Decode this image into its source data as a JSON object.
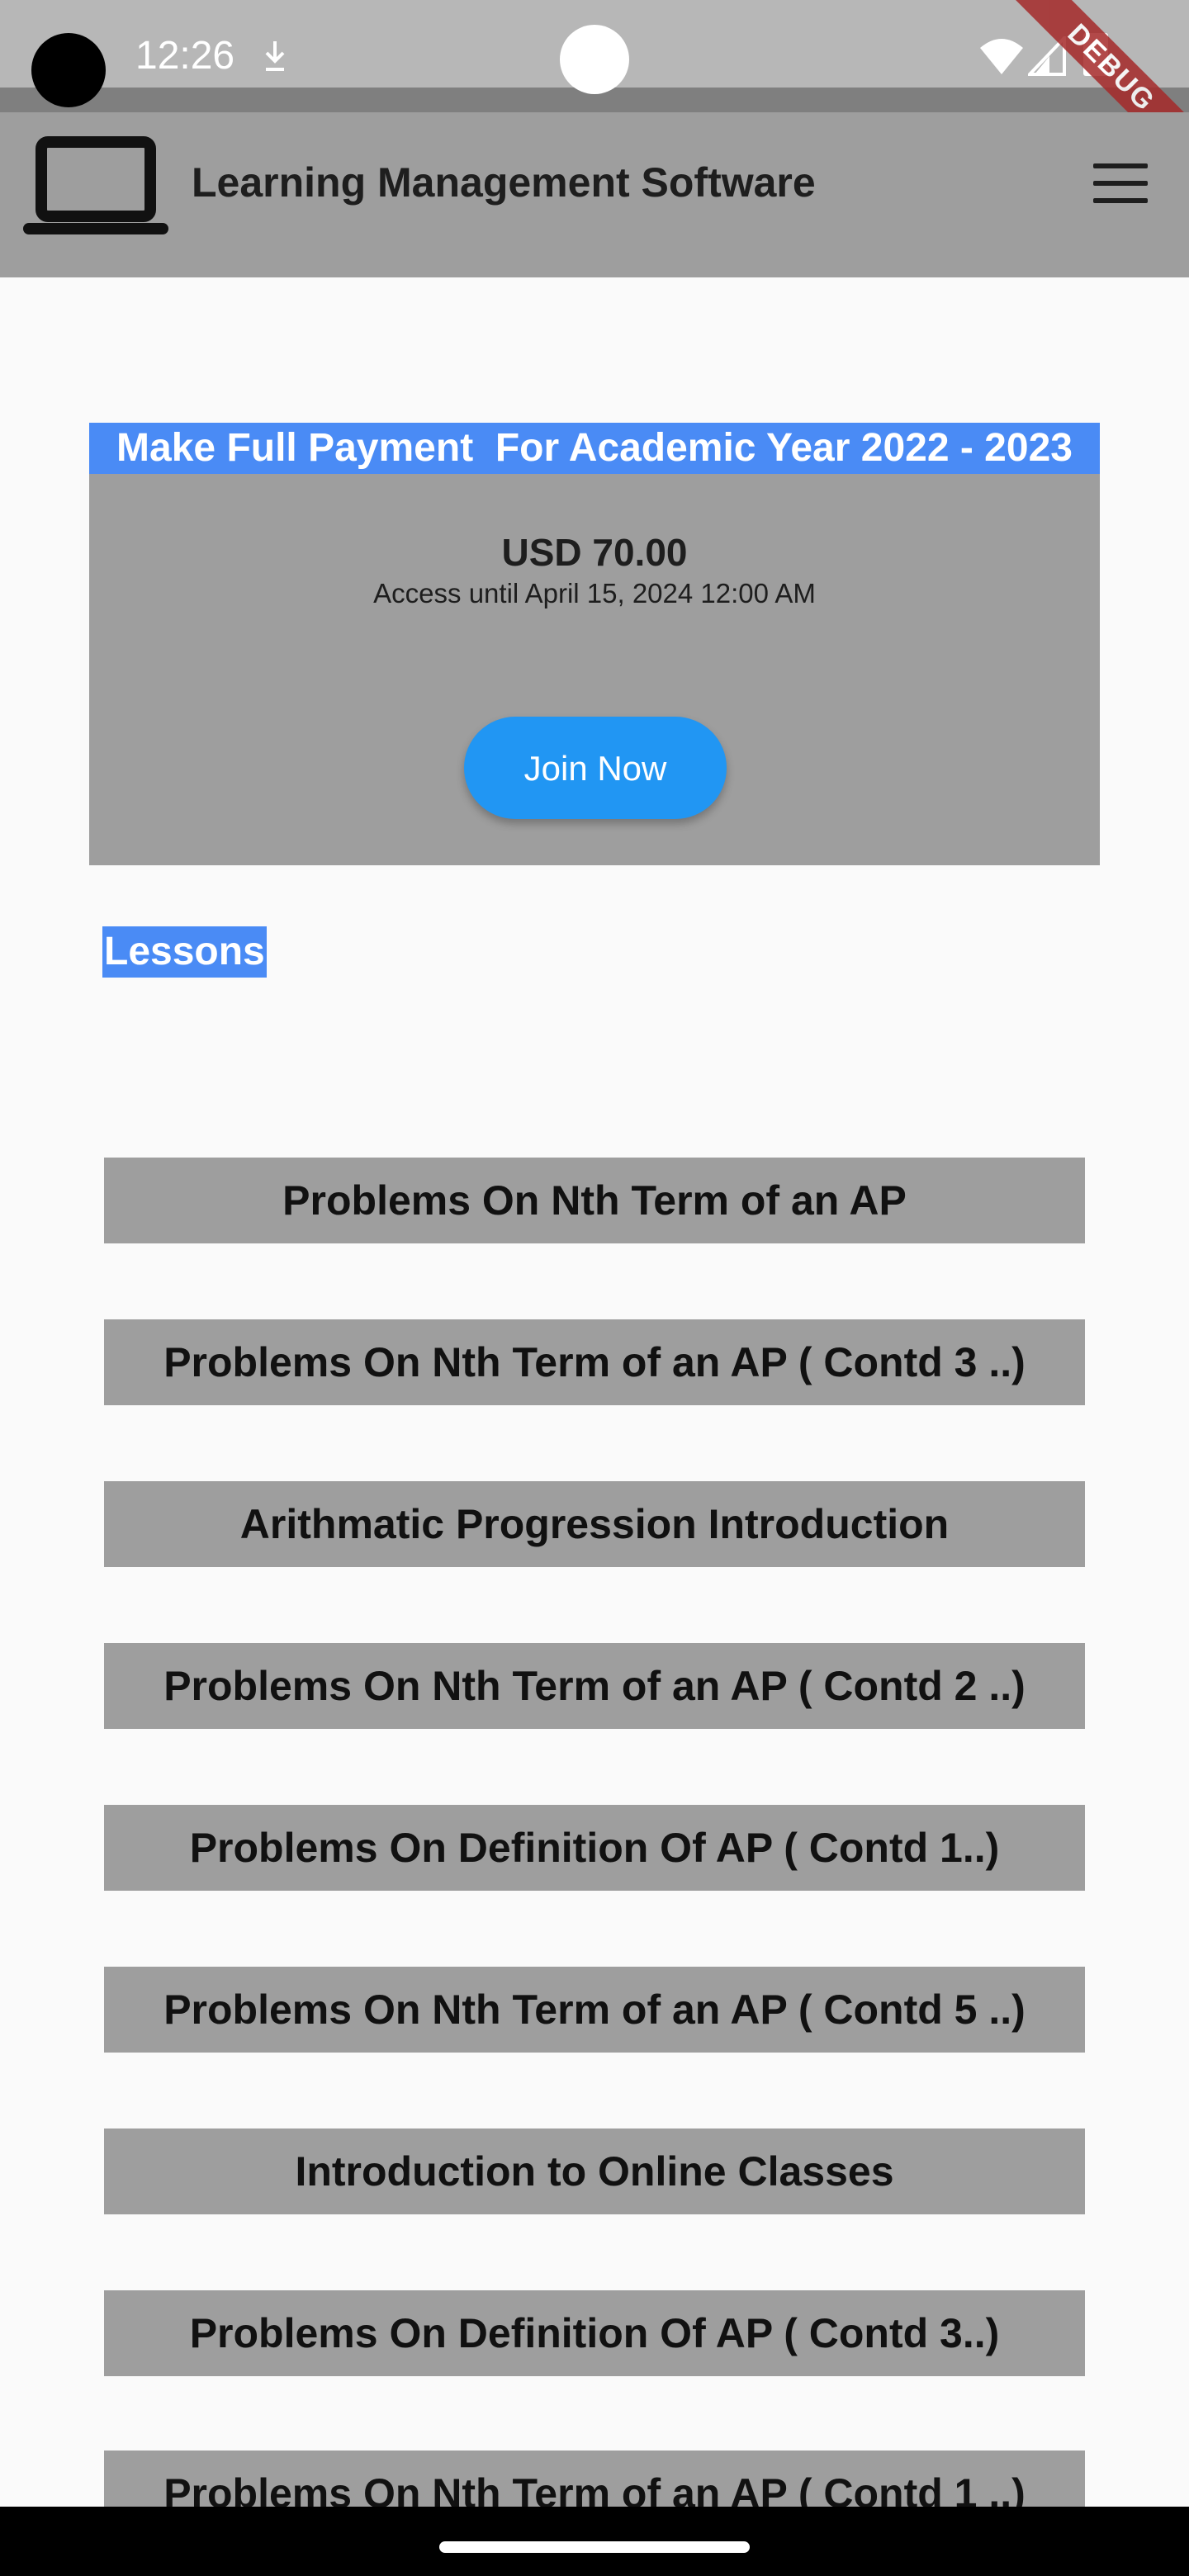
{
  "status_bar": {
    "time": "12:26",
    "debug_label": "DEBUG"
  },
  "app_bar": {
    "title": "Learning Management Software",
    "logo_icon": "laptop-icon",
    "menu_icon": "menu-icon"
  },
  "payment": {
    "header": "Make Full Payment  For Academic Year 2022 - 2023",
    "price": "USD 70.00",
    "access": "Access until April 15, 2024 12:00 AM",
    "join_label": "Join Now",
    "accent": "#4a8bf5",
    "button_color": "#2196f3"
  },
  "lessons": {
    "heading": "Lessons",
    "items": [
      "Problems On Nth Term of an AP",
      "Problems On Nth Term of an AP ( Contd 3 ..)",
      "Arithmatic Progression Introduction",
      "Problems On Nth Term of an AP ( Contd 2 ..)",
      "Problems On Definition Of AP ( Contd 1..)",
      "Problems On Nth Term of an AP ( Contd 5 ..)",
      "Introduction to Online Classes",
      "Problems On Definition Of AP ( Contd 3..)",
      "Problems On Nth Term of an AP ( Contd 1 ..)"
    ]
  }
}
